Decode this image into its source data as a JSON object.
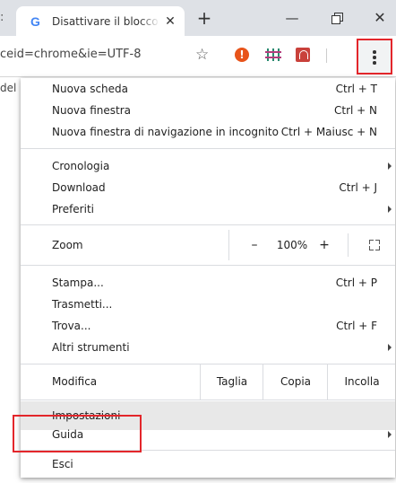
{
  "tab": {
    "prev_glyph": ":",
    "favicon": "G",
    "title": "Disattivare il blocco",
    "close": "✕",
    "new_tab": "+"
  },
  "window": {
    "minimize": "—",
    "close": "✕"
  },
  "omnibox": {
    "url": "ceid=chrome&ie=UTF-8",
    "star": "☆",
    "ext_alert": "!"
  },
  "left_under": "del",
  "menu": {
    "new_tab": {
      "label": "Nuova scheda",
      "shortcut": "Ctrl + T"
    },
    "new_window": {
      "label": "Nuova finestra",
      "shortcut": "Ctrl + N"
    },
    "incognito": {
      "label": "Nuova finestra di navigazione in incognito",
      "shortcut": "Ctrl + Maiusc + N"
    },
    "history": {
      "label": "Cronologia"
    },
    "downloads": {
      "label": "Download",
      "shortcut": "Ctrl + J"
    },
    "bookmarks": {
      "label": "Preferiti"
    },
    "zoom": {
      "label": "Zoom",
      "minus": "–",
      "level": "100%",
      "plus": "+"
    },
    "print": {
      "label": "Stampa...",
      "shortcut": "Ctrl + P"
    },
    "cast": {
      "label": "Trasmetti..."
    },
    "find": {
      "label": "Trova...",
      "shortcut": "Ctrl + F"
    },
    "more_tools": {
      "label": "Altri strumenti"
    },
    "edit": {
      "label": "Modifica",
      "cut": "Taglia",
      "copy": "Copia",
      "paste": "Incolla"
    },
    "settings": {
      "label": "Impostazioni"
    },
    "help": {
      "label": "Guida"
    },
    "exit": {
      "label": "Esci"
    }
  },
  "colors": {
    "highlight_border": "#e3262b",
    "tabstrip_bg": "#dee1e6"
  }
}
